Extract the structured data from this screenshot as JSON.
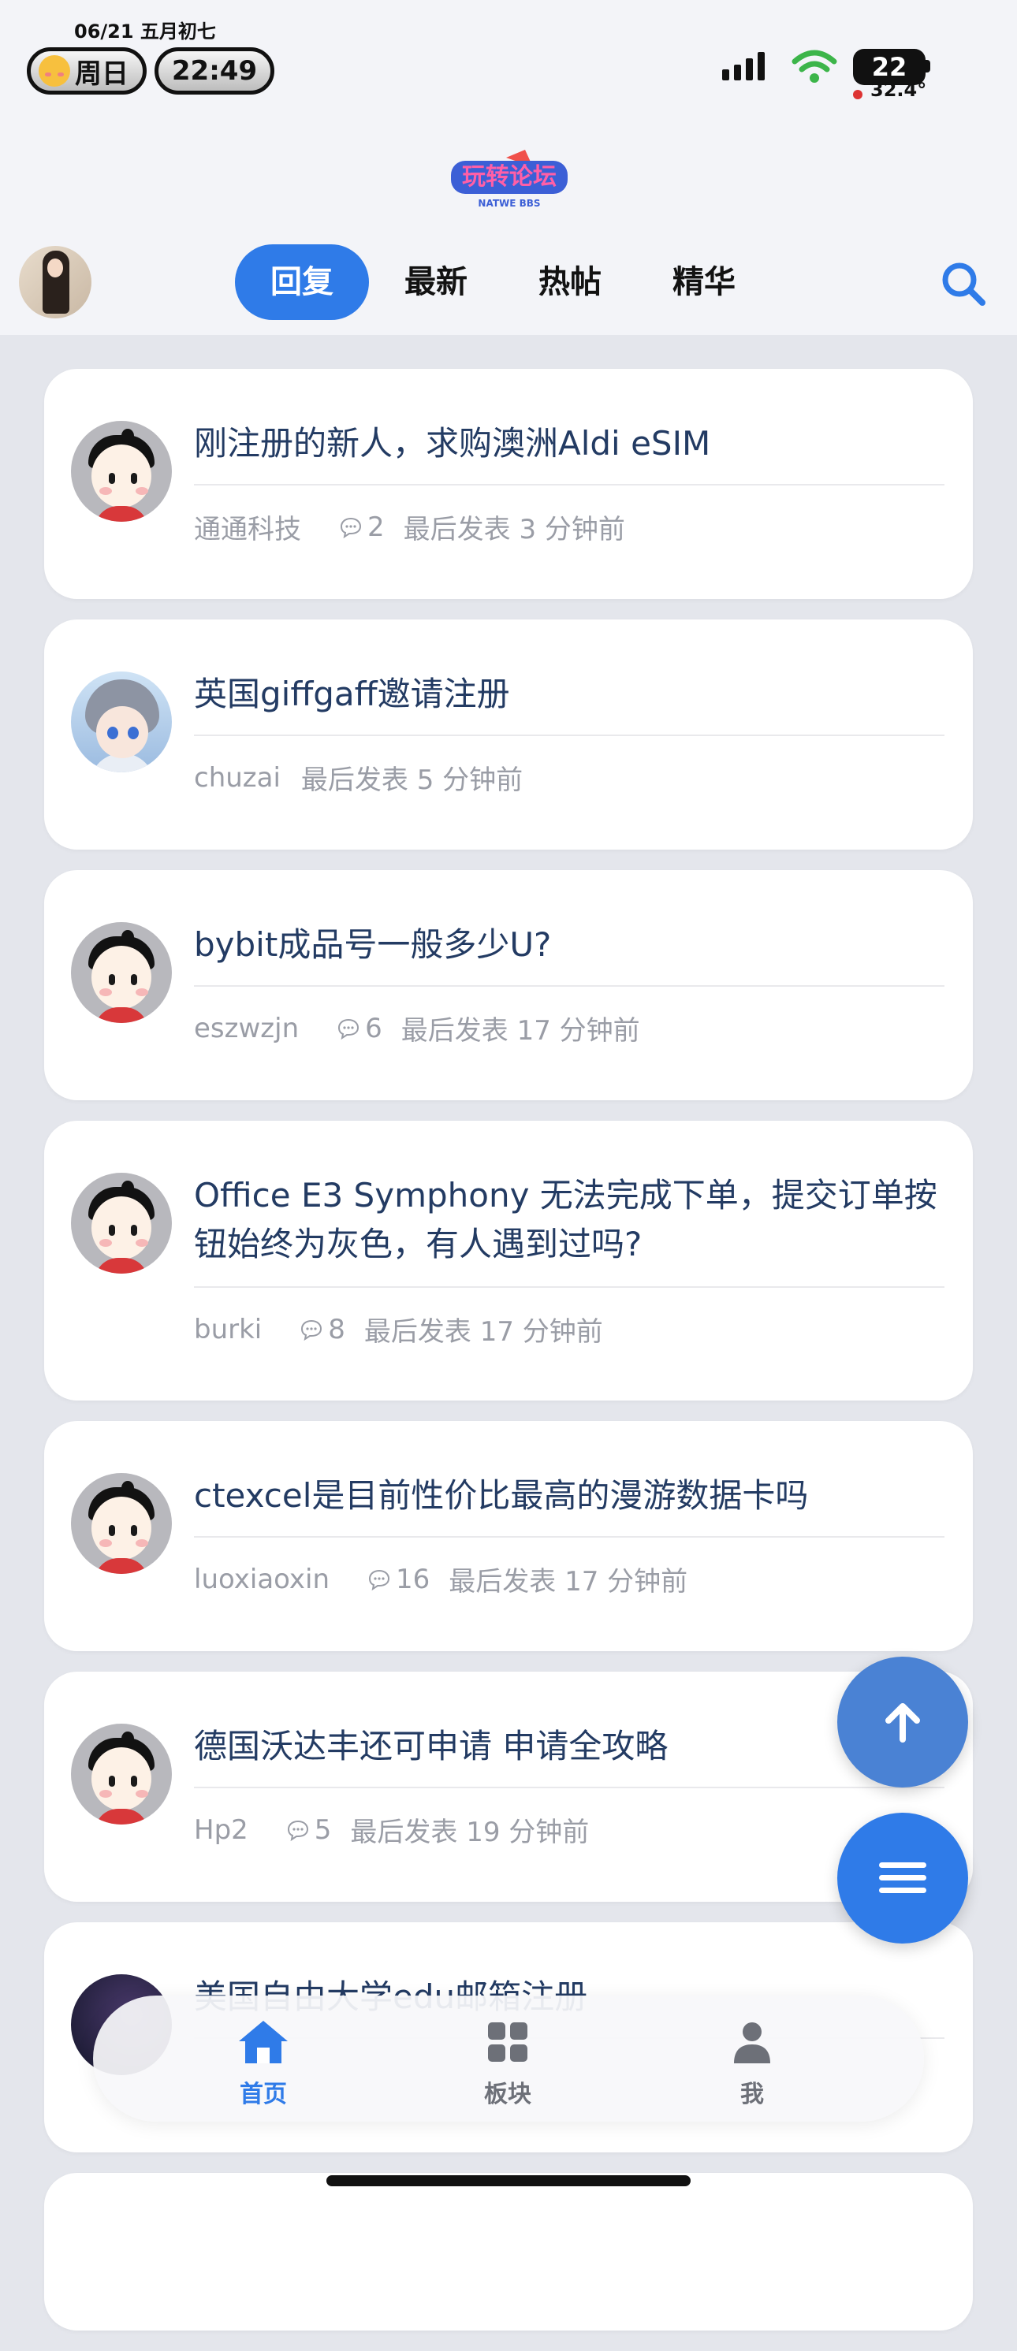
{
  "status_bar": {
    "date": "06/21 五月初七",
    "weekday": "周日",
    "time": "22:49",
    "battery": "22",
    "temperature": "32.4°"
  },
  "header": {
    "logo_text": "玩转论坛",
    "logo_subtext": "NATWE BBS",
    "tabs": [
      "回复",
      "最新",
      "热帖",
      "精华"
    ],
    "active_tab": "回复",
    "accent_color": "#2f7be8"
  },
  "threads": [
    {
      "title": "刚注册的新人，求购澳洲Aldi eSIM",
      "author": "通通科技",
      "comments": "2",
      "last_post": "最后发表 3 分钟前",
      "avatar": "cartoon-avatar"
    },
    {
      "title": "英国giffgaff邀请注册",
      "author": "chuzai",
      "comments": "",
      "last_post": "最后发表 5 分钟前",
      "avatar": "anime-avatar"
    },
    {
      "title": "bybit成品号一般多少U?",
      "author": "eszwzjn",
      "comments": "6",
      "last_post": "最后发表 17 分钟前",
      "avatar": "cartoon-avatar"
    },
    {
      "title": "Office E3 Symphony 无法完成下单，提交订单按钮始终为灰色，有人遇到过吗?",
      "author": "burki",
      "comments": "8",
      "last_post": "最后发表 17 分钟前",
      "avatar": "cartoon-avatar"
    },
    {
      "title": "ctexcel是目前性价比最高的漫游数据卡吗",
      "author": "luoxiaoxin",
      "comments": "16",
      "last_post": "最后发表 17 分钟前",
      "avatar": "cartoon-avatar"
    },
    {
      "title": "德国沃达丰还可申请 申请全攻略",
      "author": "Hp2",
      "comments": "5",
      "last_post": "最后发表 19 分钟前",
      "avatar": "cartoon-avatar"
    },
    {
      "title": "美国自由大学edu邮箱注册",
      "author": "",
      "comments": "",
      "last_post": "",
      "avatar": "dark-avatar"
    }
  ],
  "bottom_nav": [
    {
      "label": "首页",
      "icon": "home-icon",
      "active": true
    },
    {
      "label": "板块",
      "icon": "grid-icon",
      "active": false
    },
    {
      "label": "我",
      "icon": "person-icon",
      "active": false
    }
  ]
}
